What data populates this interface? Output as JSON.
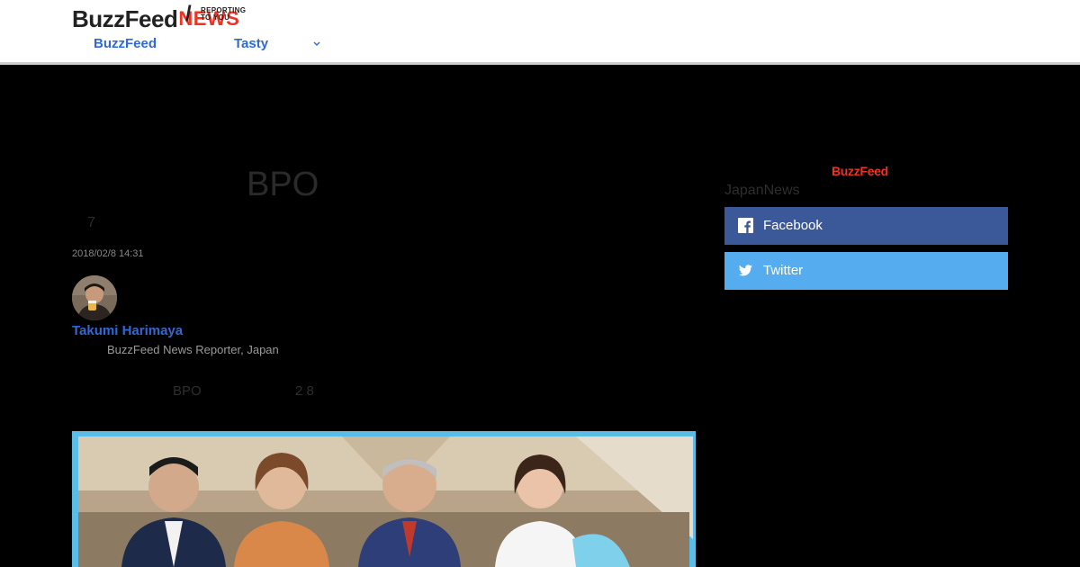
{
  "header": {
    "logo_primary": "BuzzFeed",
    "logo_secondary": "NEWS",
    "logo_tagline": "REPORTING TO YOU",
    "nav": [
      "BuzzFeed",
      "Tasty"
    ],
    "more_icon": "chevron-down-icon",
    "accent_color": "#2d6ad8",
    "brand_red": "#ee3322"
  },
  "article": {
    "headline": "BPO",
    "subheadline": "7",
    "date": "2018/02/8 14:31",
    "author": {
      "name": "Takumi Harimaya",
      "role": "BuzzFeed News Reporter, Japan"
    },
    "intro": [
      "BPO",
      "2 8"
    ]
  },
  "sidebar": {
    "logo": "BuzzFeed",
    "label": "JapanNews",
    "share": [
      {
        "label": "Facebook",
        "icon": "facebook-icon",
        "color": "#3b5998"
      },
      {
        "label": "Twitter",
        "icon": "twitter-icon",
        "color": "#55acee"
      }
    ]
  }
}
